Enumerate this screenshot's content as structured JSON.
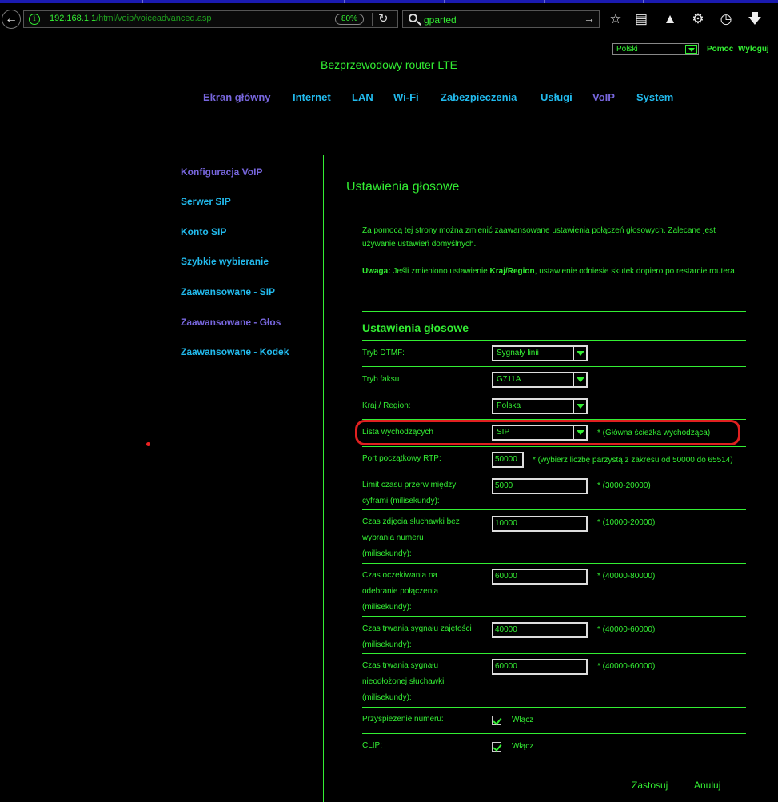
{
  "browser": {
    "url_host": "192.168.1.1",
    "url_path": "/html/voip/voiceadvanced.asp",
    "zoom": "80%",
    "search_query": "gparted"
  },
  "header": {
    "language": "Polski",
    "help": "Pomoc",
    "logout": "Wyloguj",
    "brand": "Bezprzewodowy router LTE"
  },
  "nav": [
    "Ekran główny",
    "Internet",
    "LAN",
    "Wi-Fi",
    "Zabezpieczenia",
    "Usługi",
    "VoIP",
    "System"
  ],
  "side_menu": [
    "Konfiguracja VoIP",
    "Serwer SIP",
    "Konto SIP",
    "Szybkie wybieranie",
    "Zaawansowane - SIP",
    "Zaawansowane - Głos",
    "Zaawansowane - Kodek"
  ],
  "content": {
    "title": "Ustawienia głosowe",
    "desc1": "Za pomocą tej strony można zmienić zaawansowane ustawienia połączeń głosowych. Zalecane jest używanie ustawień domyślnych.",
    "note_label": "Uwaga:",
    "note_pre": " Jeśli zmieniono ustawienie ",
    "note_bold": "Kraj/Region",
    "note_post": ", ustawienie odniesie skutek dopiero po restarcie routera.",
    "section_title": "Ustawienia głosowe",
    "fields": {
      "dtmf_label": "Tryb DTMF:",
      "dtmf_value": "Sygnały linii",
      "fax_label": "Tryb faksu",
      "fax_value": "G711A",
      "region_label": "Kraj / Region:",
      "region_value": "Polska",
      "outgoing_label": "Lista wychodzących",
      "outgoing_value": "SIP",
      "outgoing_hint": "*  (Główna ścieżka wychodząca)",
      "rtp_label": "Port początkowy RTP:",
      "rtp_value": "50000",
      "rtp_hint": "*  (wybierz liczbę parzystą z zakresu od 50000 do 65514)",
      "digit_label_1": "Limit czasu przerw między",
      "digit_label_2": "cyframi (milisekundy):",
      "digit_value": "5000",
      "digit_hint": "*  (3000-20000)",
      "offhook_label_1": "Czas zdjęcia słuchawki bez",
      "offhook_label_2": "wybrania numeru",
      "offhook_label_3": "(milisekundy):",
      "offhook_value": "10000",
      "offhook_hint": "*  (10000-20000)",
      "answer_label_1": "Czas oczekiwania na",
      "answer_label_2": "odebranie połączenia",
      "answer_label_3": "(milisekundy):",
      "answer_value": "60000",
      "answer_hint": "*  (40000-80000)",
      "busy_label_1": "Czas trwania sygnału zajętości",
      "busy_label_2": "(milisekundy):",
      "busy_value": "40000",
      "busy_hint": "*  (40000-60000)",
      "hangup_label_1": "Czas trwania sygnału",
      "hangup_label_2": "nieodłożonej słuchawki",
      "hangup_label_3": "(milisekundy):",
      "hangup_value": "60000",
      "hangup_hint": "*  (40000-60000)",
      "speedup_label": "Przyspiezenie numeru:",
      "speedup_check": "Włącz",
      "clip_label": "CLIP:",
      "clip_check": "Włącz"
    },
    "apply": "Zastosuj",
    "cancel": "Anuluj"
  }
}
